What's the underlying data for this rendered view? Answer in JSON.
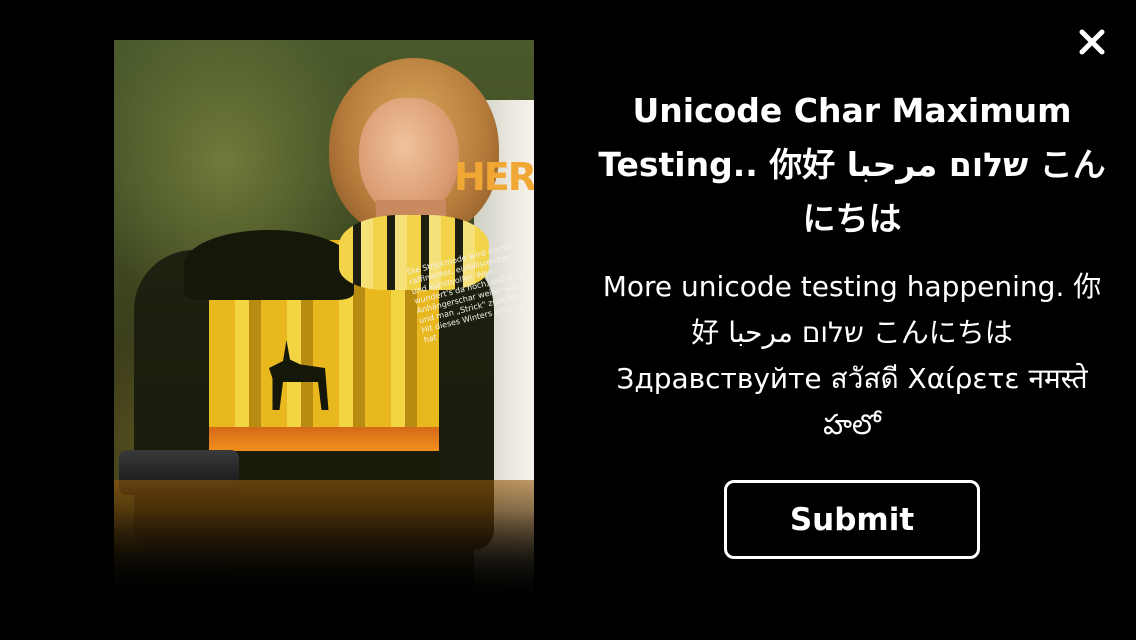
{
  "modal": {
    "title": "Unicode Char Maximum Testing.. 你好 שלום مرحبا こんにちは",
    "body": "More unicode testing happening. 你好 שלום مرحبا こんにちは Здравствуйте สวัสดี Χαίρετε नमस्ते హలో",
    "submit_label": "Submit",
    "close_icon": "close-icon"
  },
  "image": {
    "heading_text": "HER",
    "caption_text": "Die Strickmode wird immer raffinierter, einfallsreicher und kunstvoller. Wen wundert's da noch, daß ihre Anhängerschar weiter wächst und man „Strick\" zum Mode-Hit dieses Winters ernannt hat"
  },
  "colors": {
    "background": "#000000",
    "text": "#ffffff",
    "button_border": "#ffffff"
  }
}
